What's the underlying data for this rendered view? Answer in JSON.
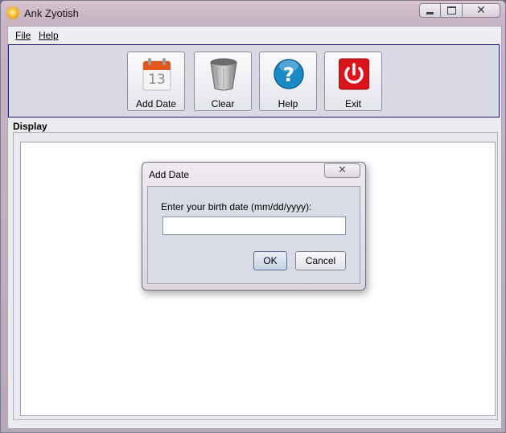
{
  "window": {
    "title": "Ank Zyotish",
    "buttons": {
      "minimize": "minimize",
      "maximize": "maximize",
      "close": "close"
    }
  },
  "menu": {
    "file": "File",
    "help": "Help"
  },
  "toolbar": {
    "add_date": {
      "label": "Add Date",
      "icon": "calendar-icon",
      "calendar_day": "13"
    },
    "clear": {
      "label": "Clear",
      "icon": "trash-icon"
    },
    "help": {
      "label": "Help",
      "icon": "help-icon"
    },
    "exit": {
      "label": "Exit",
      "icon": "power-icon"
    }
  },
  "display": {
    "label": "Display"
  },
  "dialog": {
    "title": "Add Date",
    "prompt": "Enter your birth date (mm/dd/yyyy):",
    "input_value": "",
    "ok_label": "OK",
    "cancel_label": "Cancel"
  },
  "colors": {
    "toolbar_border": "#1b1b7a",
    "exit_red": "#d9141b",
    "help_blue": "#1b8ac4"
  }
}
